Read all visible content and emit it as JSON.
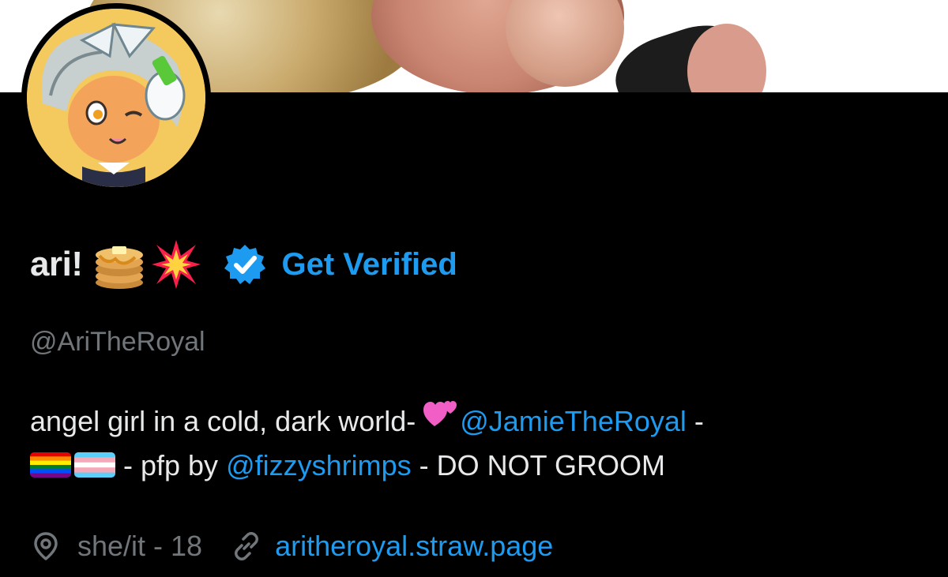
{
  "banner": {
    "image": "header-photo"
  },
  "avatar": {
    "image": "profile-picture"
  },
  "profile": {
    "display_name": "ari!",
    "name_emoji_1": "pancakes-icon",
    "name_emoji_2": "collision-icon",
    "verified_icon": "verified-badge-icon",
    "get_verified_label": "Get Verified",
    "handle": "@AriTheRoyal"
  },
  "bio": {
    "line1_text": "angel girl in a cold, dark world- ",
    "line1_emoji": "two-hearts-icon",
    "mention_1": "@JamieTheRoyal",
    "line1_end": " -",
    "flag_1": "rainbow-flag-icon",
    "flag_2": "transgender-flag-icon",
    "line2_text": " - pfp by ",
    "mention_2": "@fizzyshrimps",
    "line2_end": " - DO NOT GROOM"
  },
  "meta": {
    "location_icon": "location-pin-icon",
    "location_text": "she/it - 18",
    "link_icon": "link-icon",
    "website": "aritheroyal.straw.page"
  },
  "colors": {
    "background": "#000000",
    "primary_text": "#e7e9ea",
    "secondary_text": "#71767b",
    "accent": "#1d9bf0"
  }
}
